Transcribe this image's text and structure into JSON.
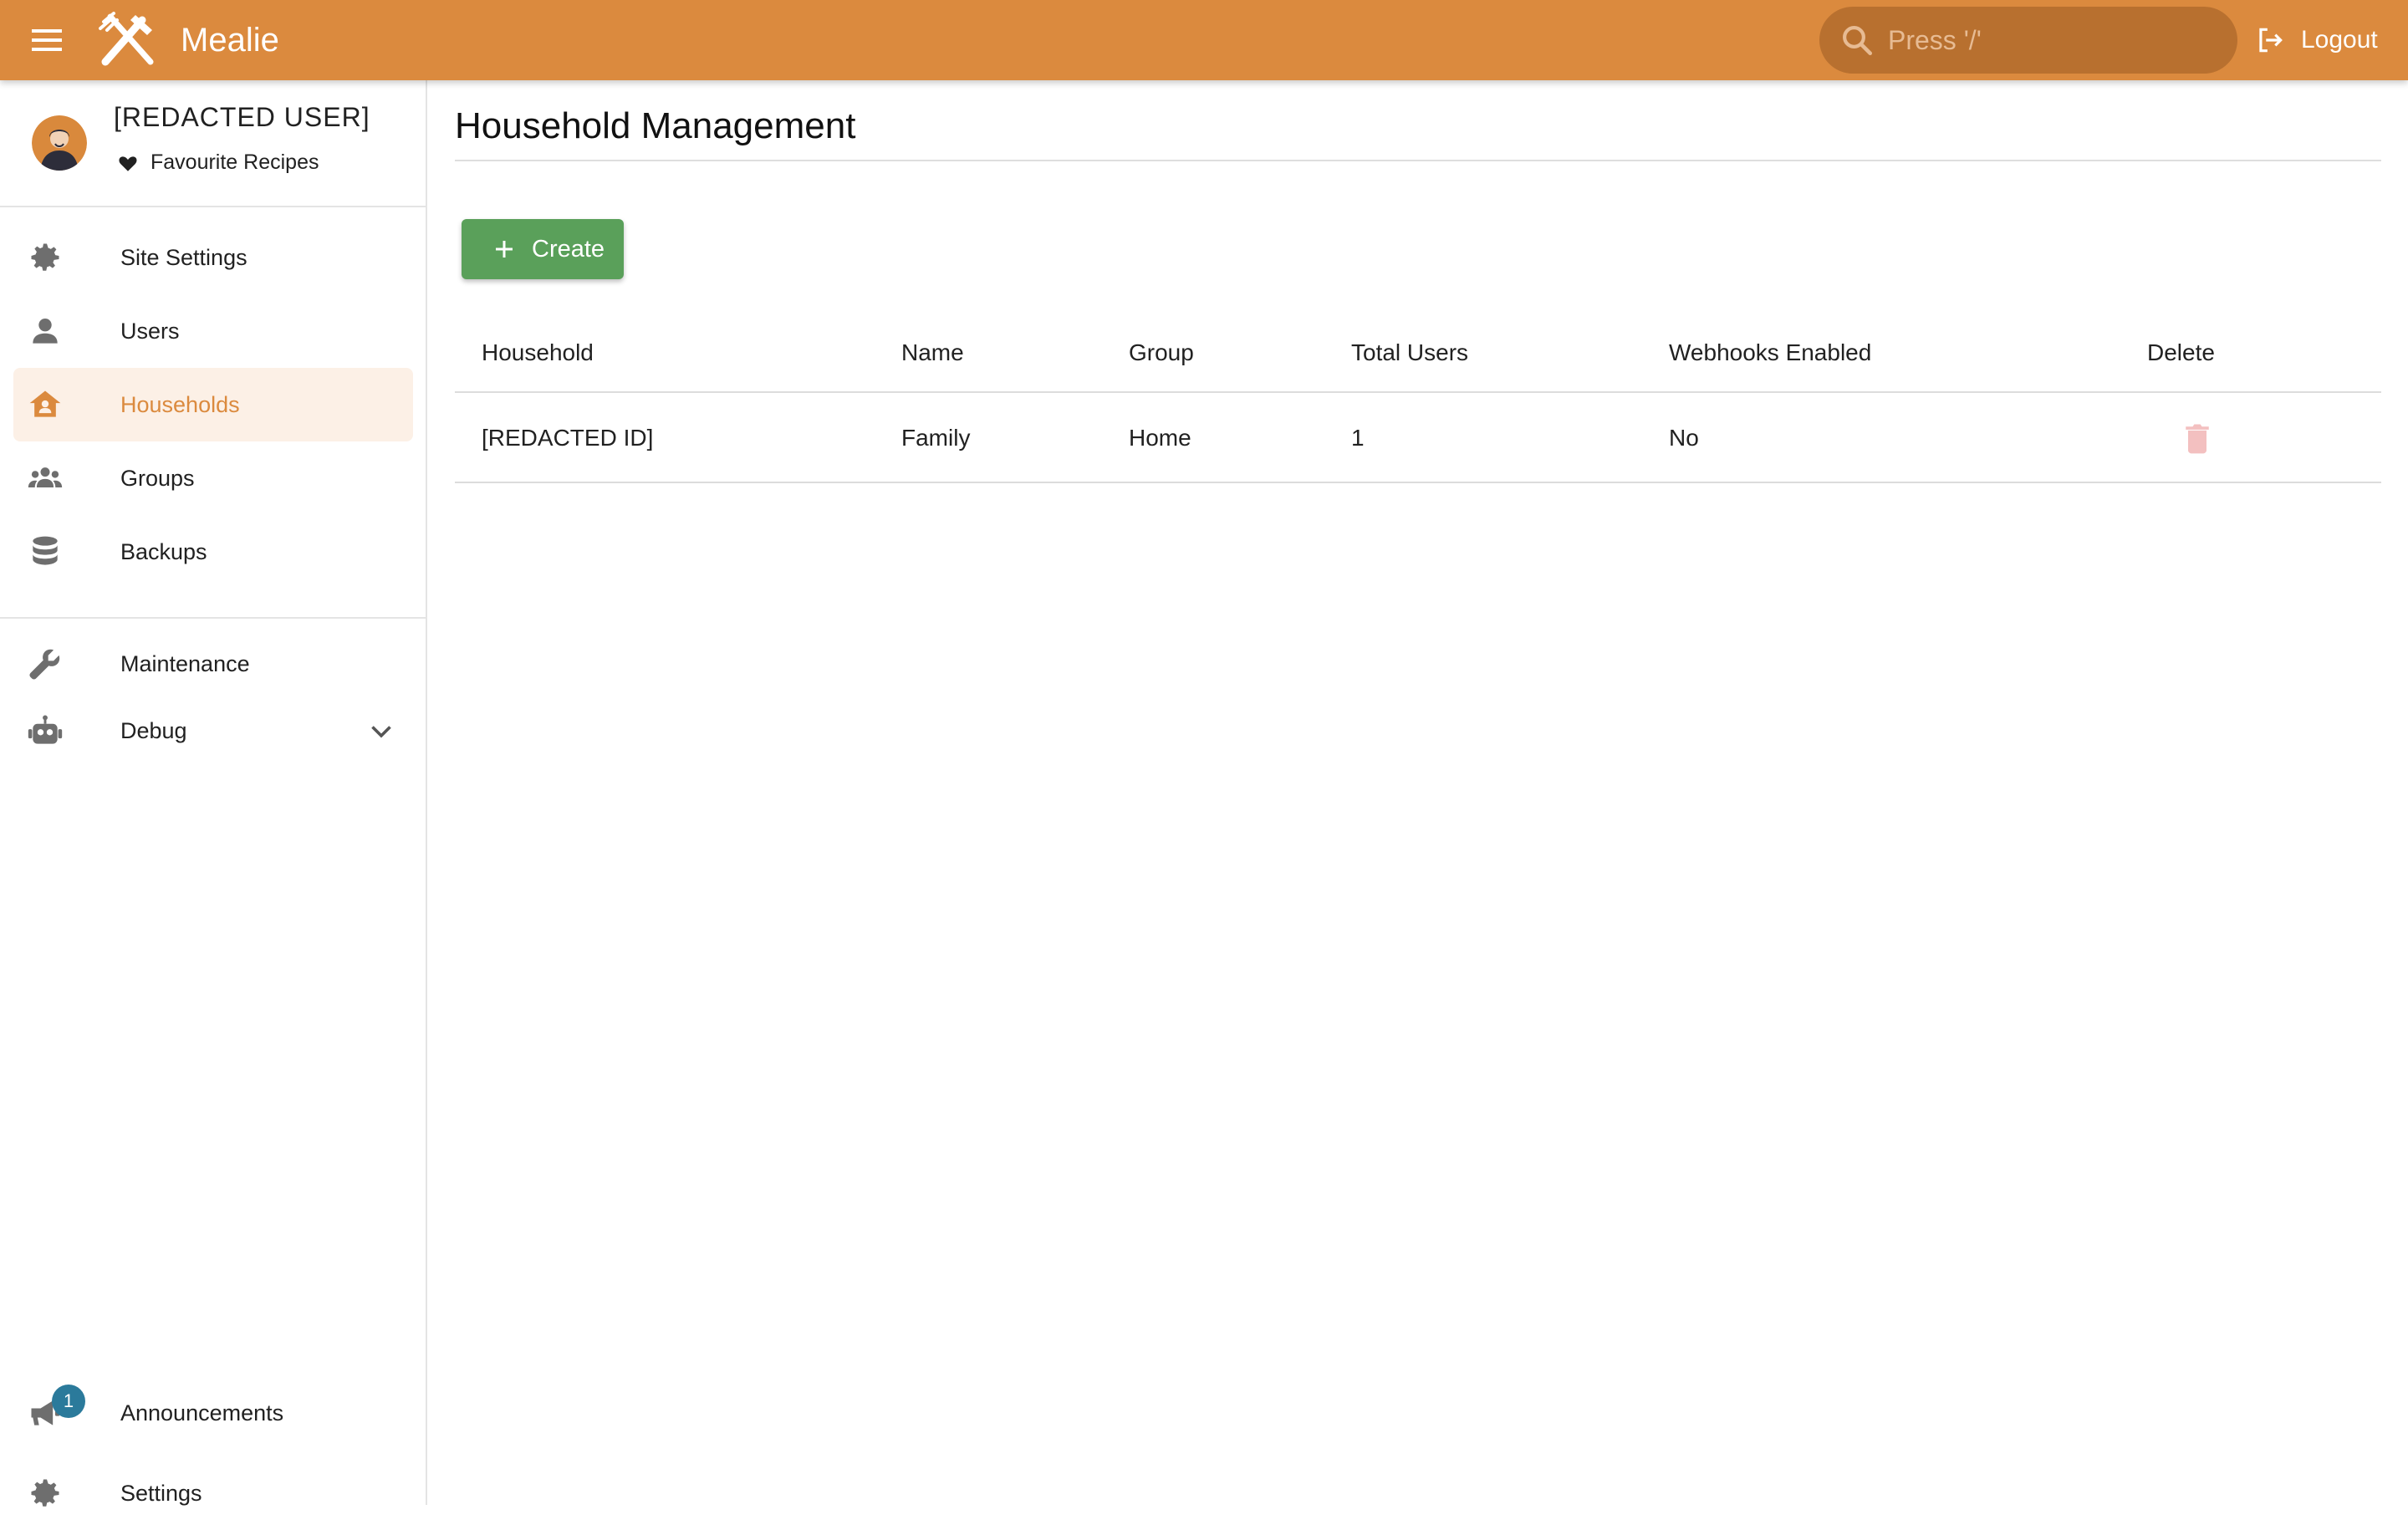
{
  "header": {
    "brand": "Mealie",
    "search_placeholder": "Press '/'",
    "logout_label": "Logout",
    "accent_color": "#db8a3e"
  },
  "sidebar": {
    "user_name": "[REDACTED USER]",
    "favourites_label": "Favourite Recipes",
    "items": [
      {
        "label": "Site Settings",
        "icon": "gear-icon"
      },
      {
        "label": "Users",
        "icon": "user-icon"
      },
      {
        "label": "Households",
        "icon": "household-icon",
        "active": true
      },
      {
        "label": "Groups",
        "icon": "group-icon"
      },
      {
        "label": "Backups",
        "icon": "database-icon"
      }
    ],
    "tools": [
      {
        "label": "Maintenance",
        "icon": "wrench-icon"
      },
      {
        "label": "Debug",
        "icon": "robot-icon"
      }
    ],
    "footer": [
      {
        "label": "Announcements",
        "icon": "megaphone-icon",
        "badge": "1"
      },
      {
        "label": "Settings",
        "icon": "gear-icon"
      }
    ]
  },
  "main": {
    "title": "Household Management",
    "create_label": "Create",
    "table": {
      "columns": [
        "Household",
        "Name",
        "Group",
        "Total Users",
        "Webhooks Enabled",
        "Delete"
      ],
      "rows": [
        {
          "household": "[REDACTED ID]",
          "name": "Family",
          "group": "Home",
          "total_users": "1",
          "webhooks": "No"
        }
      ]
    }
  }
}
